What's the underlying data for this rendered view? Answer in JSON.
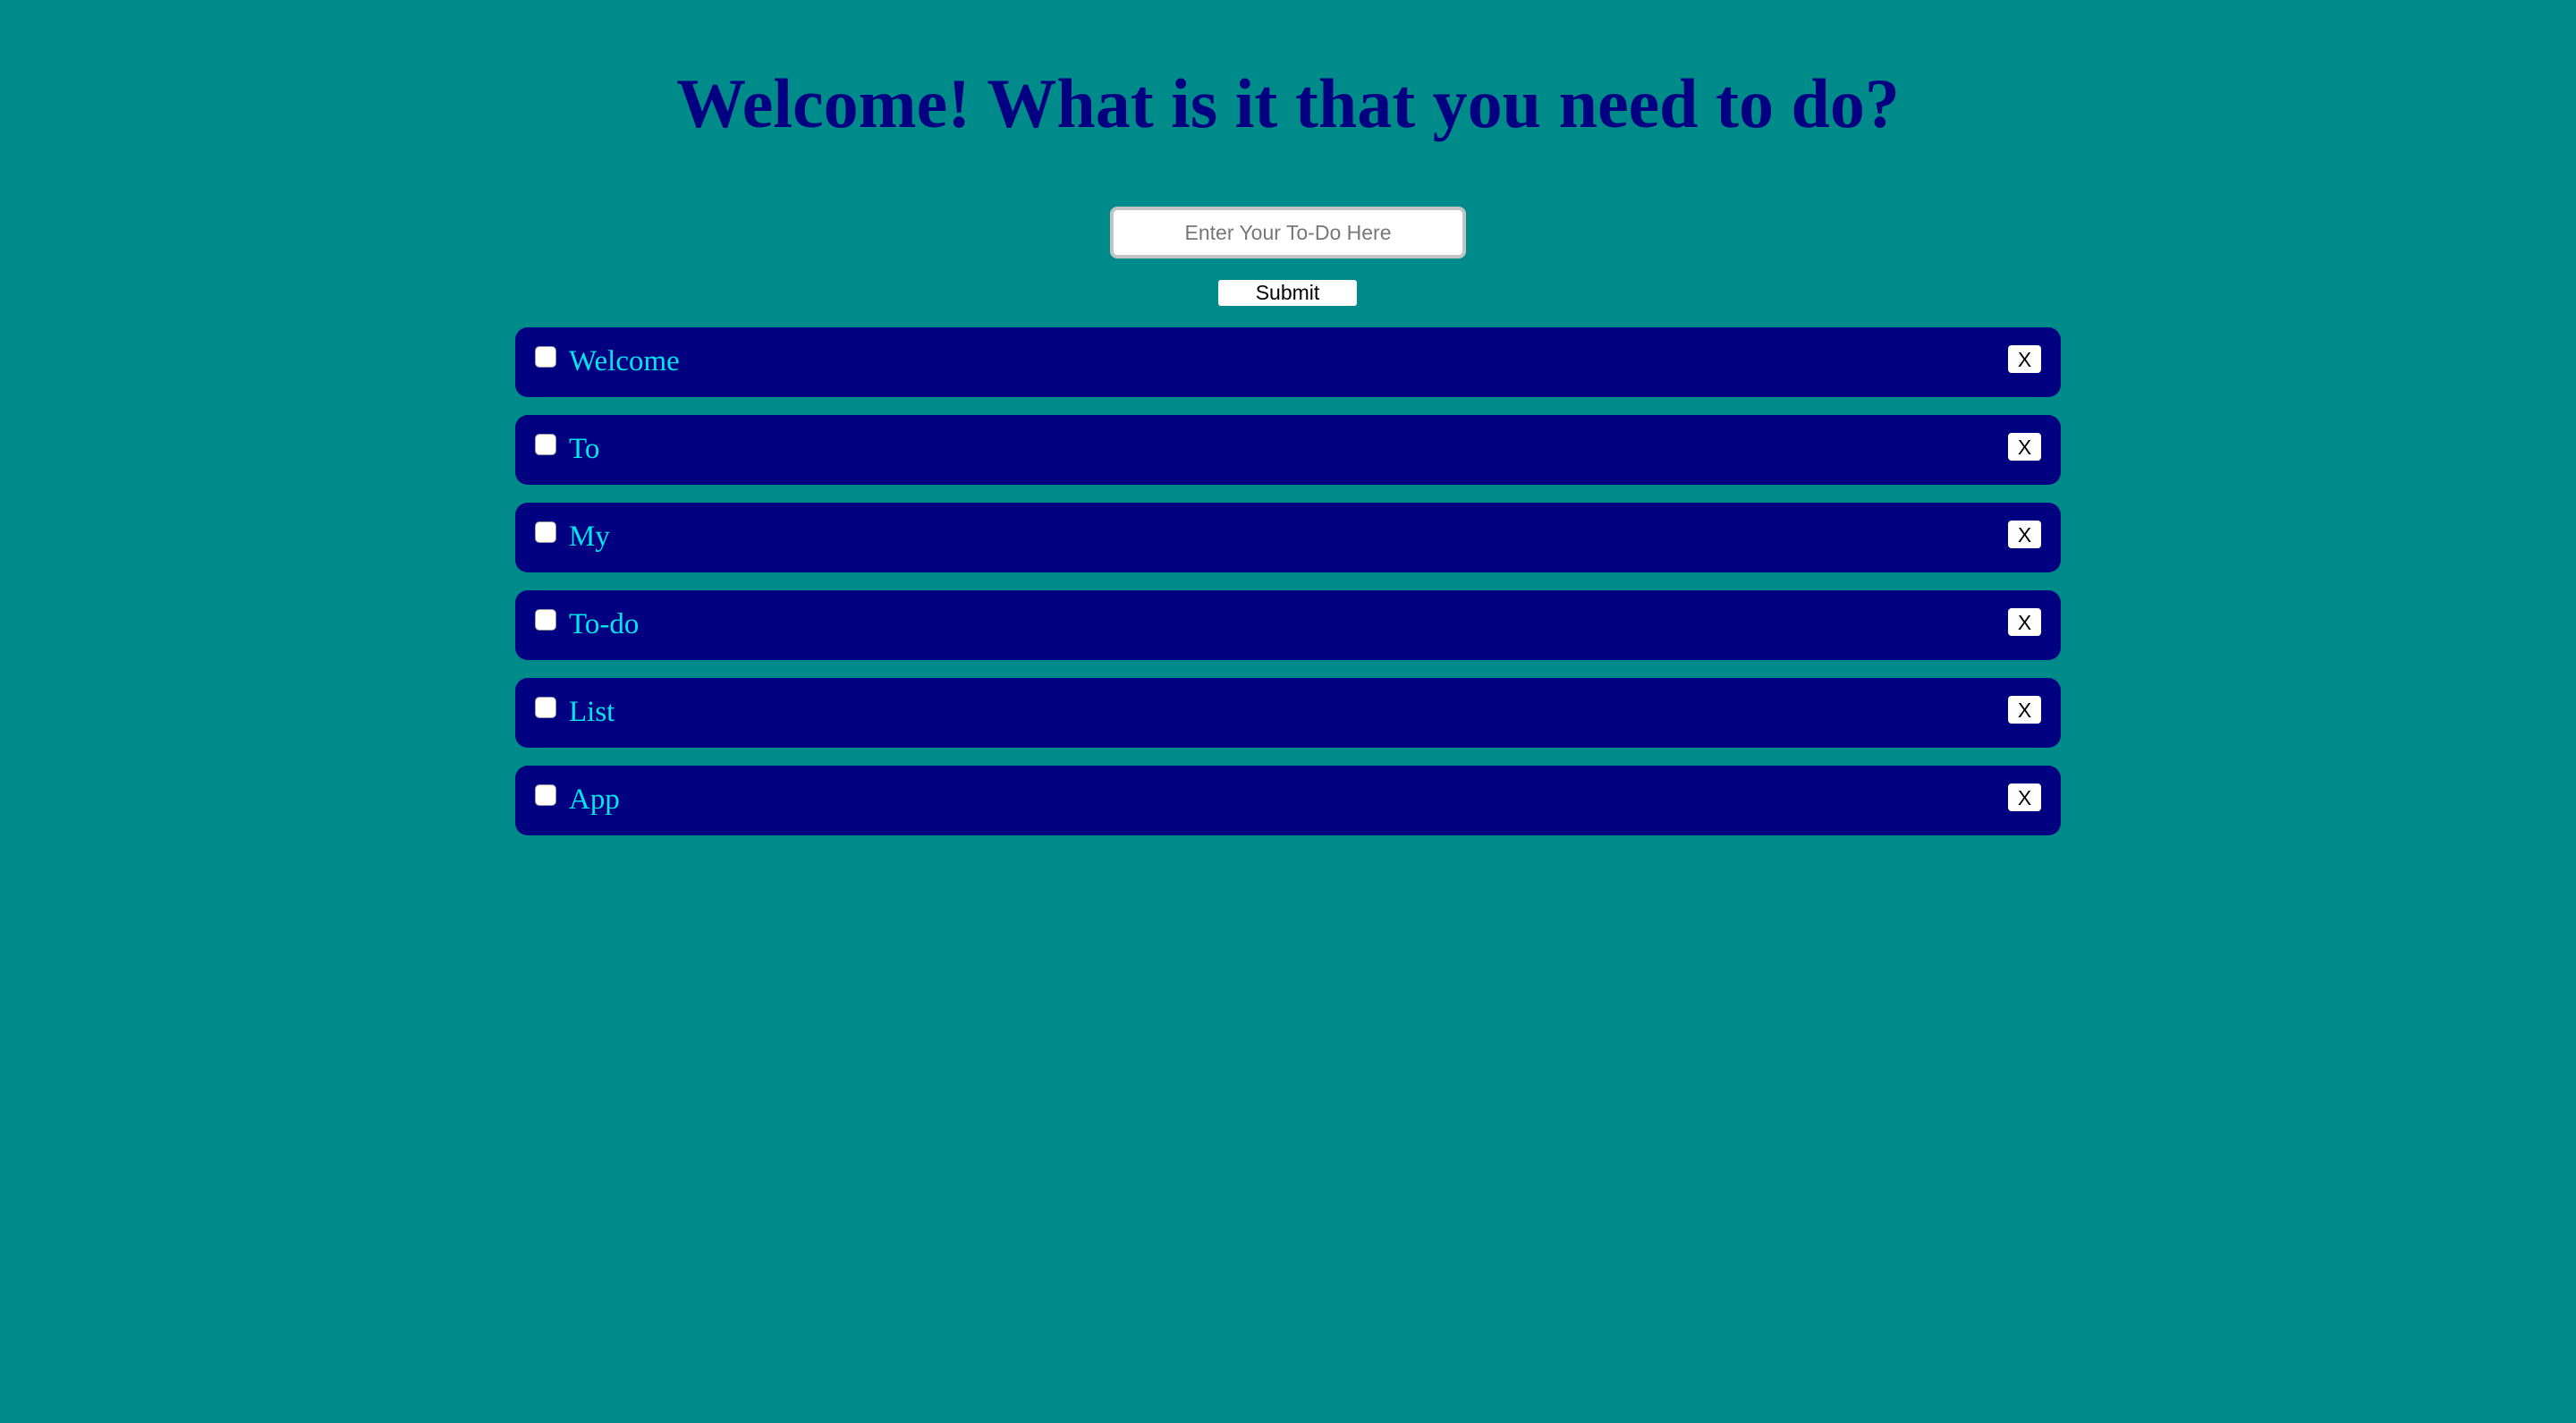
{
  "header": {
    "title": "Welcome! What is it that you need to do?"
  },
  "form": {
    "input_placeholder": "Enter Your To-Do Here",
    "input_value": "",
    "submit_label": "Submit"
  },
  "todos": [
    {
      "text": "Welcome",
      "checked": false,
      "delete_label": "X"
    },
    {
      "text": "To",
      "checked": false,
      "delete_label": "X"
    },
    {
      "text": "My",
      "checked": false,
      "delete_label": "X"
    },
    {
      "text": "To-do",
      "checked": false,
      "delete_label": "X"
    },
    {
      "text": "List",
      "checked": false,
      "delete_label": "X"
    },
    {
      "text": "App",
      "checked": false,
      "delete_label": "X"
    }
  ],
  "colors": {
    "background": "#008B8B",
    "title": "#000080",
    "item_background": "#000080",
    "item_text": "#00E5EE"
  }
}
